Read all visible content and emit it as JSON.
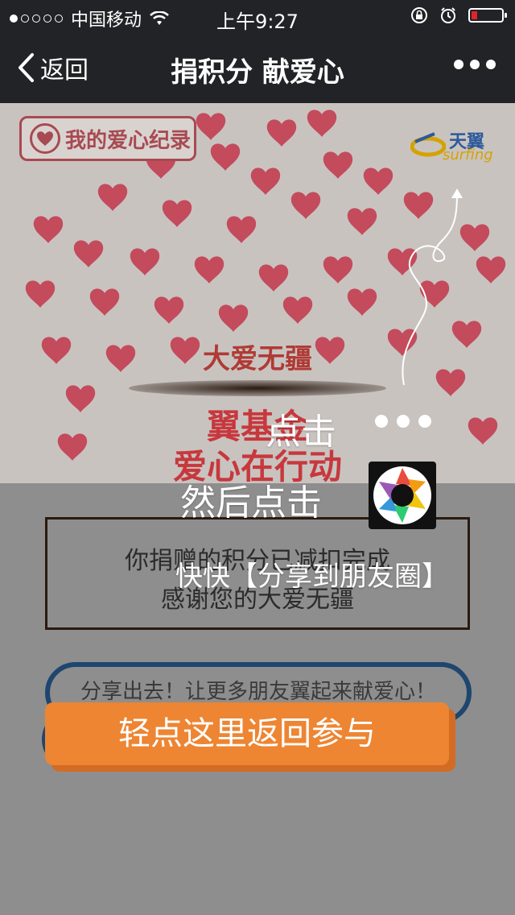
{
  "status": {
    "carrier": "中国移动",
    "time": "上午9:27"
  },
  "nav": {
    "back_label": "返回",
    "title": "捐积分 献爱心"
  },
  "banner": {
    "badge_label": "我的爱心纪录",
    "logo_cn": "天翼",
    "logo_en": "surfing",
    "line1": "大爱无疆",
    "line2": "翼基金",
    "line3": "爱心在行动"
  },
  "content": {
    "done_line1": "你捐赠的积分已减扣完成",
    "done_line2": "感谢您的大爱无疆",
    "share_label": "分享出去！让更多朋友翼起来献爱心！",
    "return_label": "轻点这里返回参与"
  },
  "overlay": {
    "step1": "点击",
    "step2": "然后点击",
    "step3": "快快【分享到朋友圈】"
  }
}
